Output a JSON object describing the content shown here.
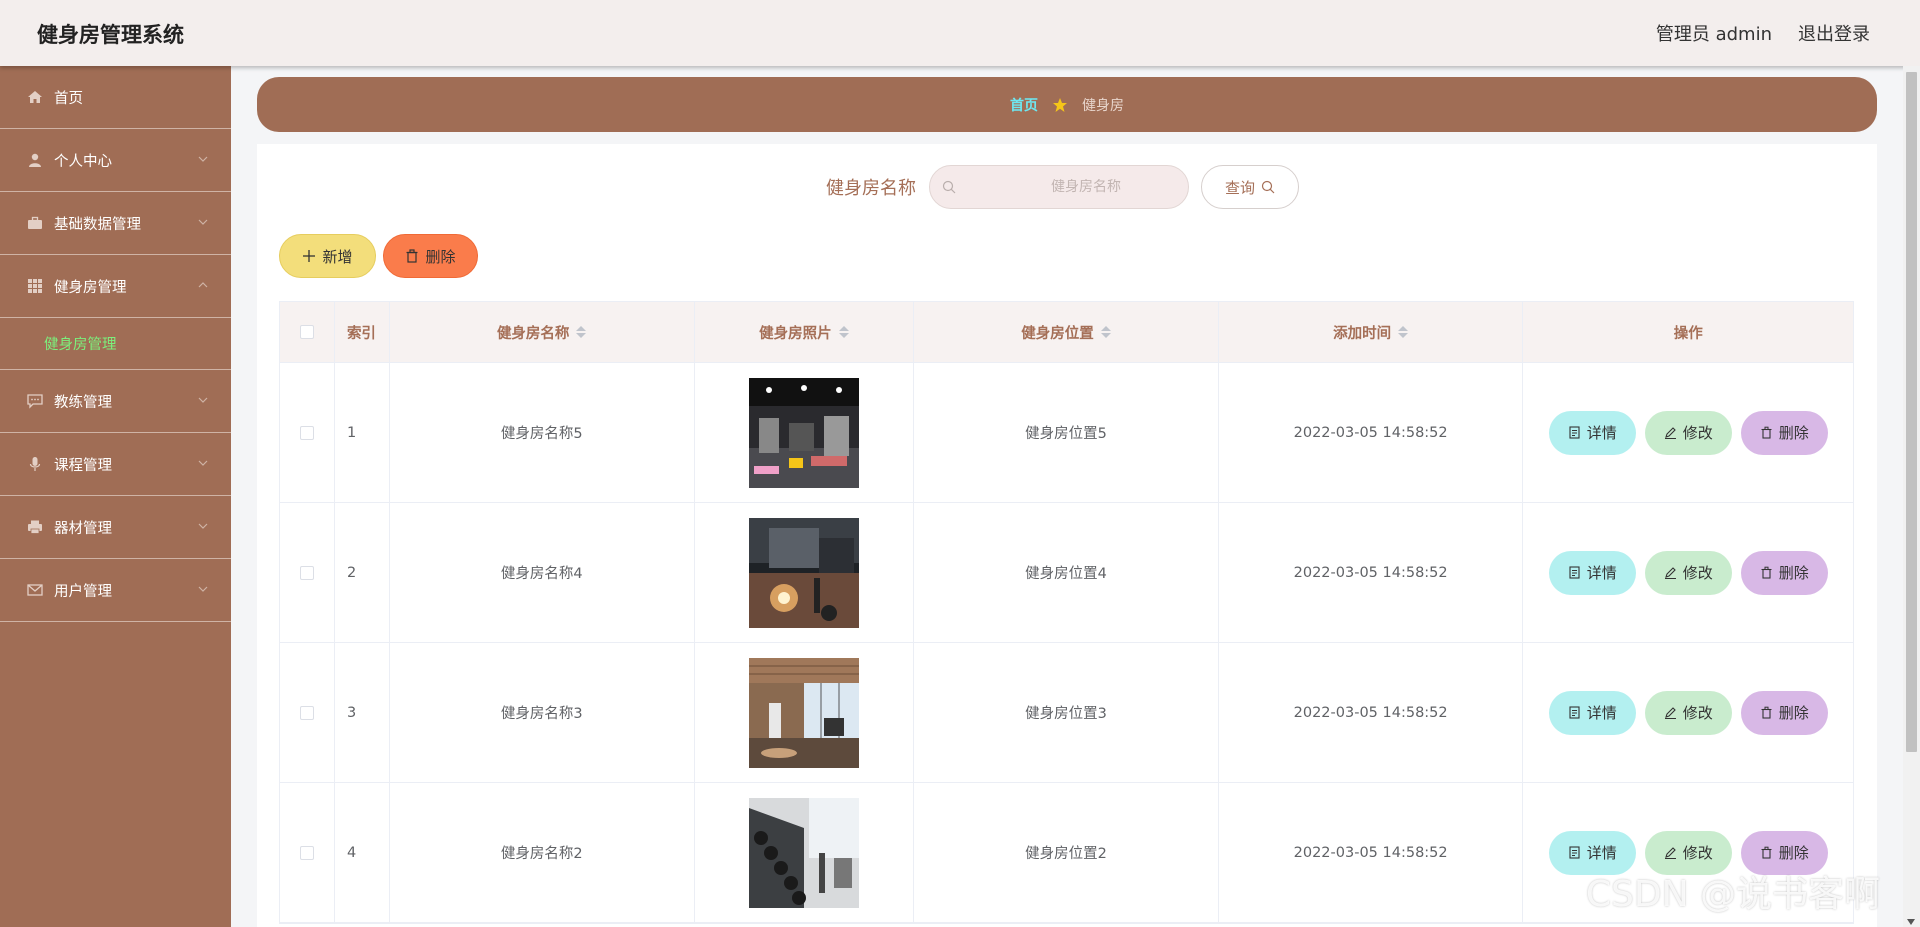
{
  "header": {
    "title": "健身房管理系统",
    "user": "管理员 admin",
    "logout": "退出登录"
  },
  "sidebar": {
    "items": [
      {
        "label": "首页",
        "icon": "home-icon"
      },
      {
        "label": "个人中心",
        "icon": "user-icon"
      },
      {
        "label": "基础数据管理",
        "icon": "briefcase-icon"
      },
      {
        "label": "健身房管理",
        "icon": "grid-icon"
      },
      {
        "label": "教练管理",
        "icon": "chat-icon"
      },
      {
        "label": "课程管理",
        "icon": "mic-icon"
      },
      {
        "label": "器材管理",
        "icon": "printer-icon"
      },
      {
        "label": "用户管理",
        "icon": "mail-icon"
      }
    ],
    "active_sub": "健身房管理"
  },
  "breadcrumb": {
    "home": "首页",
    "current": "健身房"
  },
  "search": {
    "label": "健身房名称",
    "placeholder": "健身房名称",
    "button": "查询"
  },
  "actions": {
    "add": "新增",
    "delete": "删除"
  },
  "table": {
    "headers": {
      "index": "索引",
      "name": "健身房名称",
      "photo": "健身房照片",
      "location": "健身房位置",
      "time": "添加时间",
      "ops": "操作"
    },
    "rows": [
      {
        "index": "1",
        "name": "健身房名称5",
        "location": "健身房位置5",
        "time": "2022-03-05 14:58:52"
      },
      {
        "index": "2",
        "name": "健身房名称4",
        "location": "健身房位置4",
        "time": "2022-03-05 14:58:52"
      },
      {
        "index": "3",
        "name": "健身房名称3",
        "location": "健身房位置3",
        "time": "2022-03-05 14:58:52"
      },
      {
        "index": "4",
        "name": "健身房名称2",
        "location": "健身房位置2",
        "time": "2022-03-05 14:58:52"
      }
    ],
    "ops": {
      "detail": "详情",
      "edit": "修改",
      "remove": "删除"
    }
  },
  "watermark": "CSDN @说书客啊",
  "colors": {
    "sidebar": "#a06d55",
    "accent_text": "#a56f57",
    "active_submenu": "#7cf07c"
  }
}
